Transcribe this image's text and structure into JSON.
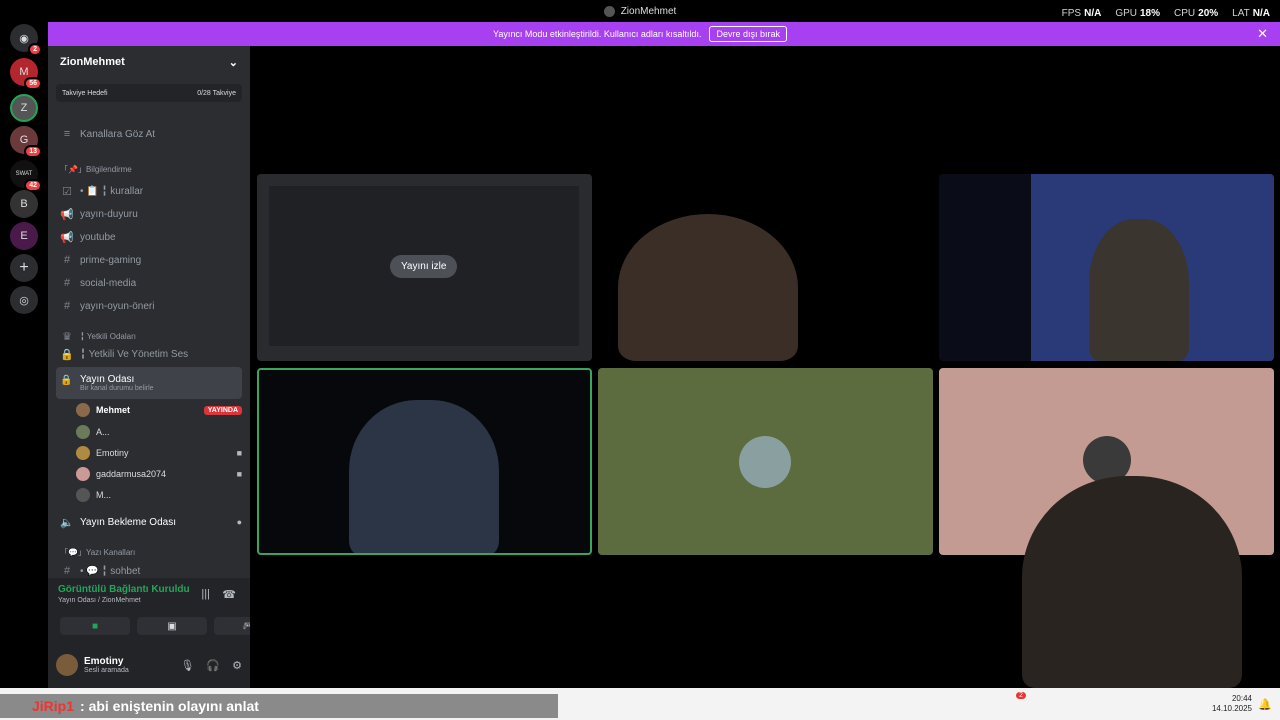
{
  "window": {
    "title": "ZionMehmet"
  },
  "stats": {
    "fps_label": "FPS",
    "fps_value": "N/A",
    "gpu_label": "GPU",
    "gpu_value": "18%",
    "cpu_label": "CPU",
    "cpu_value": "20%",
    "lat_label": "LAT",
    "lat_value": "N/A"
  },
  "banner": {
    "text": "Yayıncı Modu etkinleştirildi. Kullanıcı adları kısaltıldı.",
    "button": "Devre dışı bırak"
  },
  "servers": {
    "badges": [
      "2",
      "56",
      "13",
      "42"
    ],
    "labels": [
      "SWAT"
    ]
  },
  "sidebar": {
    "guild_name": "ZionMehmet",
    "boost_label": "Takviye Hedefi",
    "boost_value": "0/28 Takviye",
    "browse": "Kanallara Göz At",
    "cat_info": "「📌」Bilgilendirme",
    "ch_rules": "• 📋 ╏ kurallar",
    "ch_announce": "yayın-duyuru",
    "ch_youtube": "youtube",
    "ch_prime": "prime-gaming",
    "ch_social": "social-media",
    "ch_suggest": "yayın-oyun-öneri",
    "cat_auth": "╏ Yetkili Odaları",
    "ch_auth_voice": "╏ Yetkili Ve Yönetim Ses",
    "ch_stream_room": "Yayın Odası",
    "ch_stream_status": "Bir kanal durumu belirle",
    "users": [
      "Mehmet",
      "A...",
      "Emotiny",
      "gaddarmusa2074",
      "M..."
    ],
    "live_label": "YAYINDA",
    "ch_waiting": "Yayın Bekleme Odası",
    "cat_text": "「💬」Yazı Kanalları",
    "ch_chat": "• 💬 ╏ sohbet"
  },
  "voice": {
    "status": "Görüntülü Bağlantı Kuruldu",
    "location": "Yayın Odası / ZionMehmet"
  },
  "user_panel": {
    "name": "Emotiny",
    "status": "Sesli aramada"
  },
  "main": {
    "watch_button": "Yayını izle"
  },
  "ticker": {
    "nick": "JiRip1",
    "text": ": abi eniştenin olayını anlat"
  },
  "taskbar": {
    "time": "20:44",
    "date": "14.10.2025",
    "notif_badge": "2"
  },
  "colors": {
    "accent": "#a640f0",
    "live": "#da373c",
    "connected": "#23a55a"
  }
}
